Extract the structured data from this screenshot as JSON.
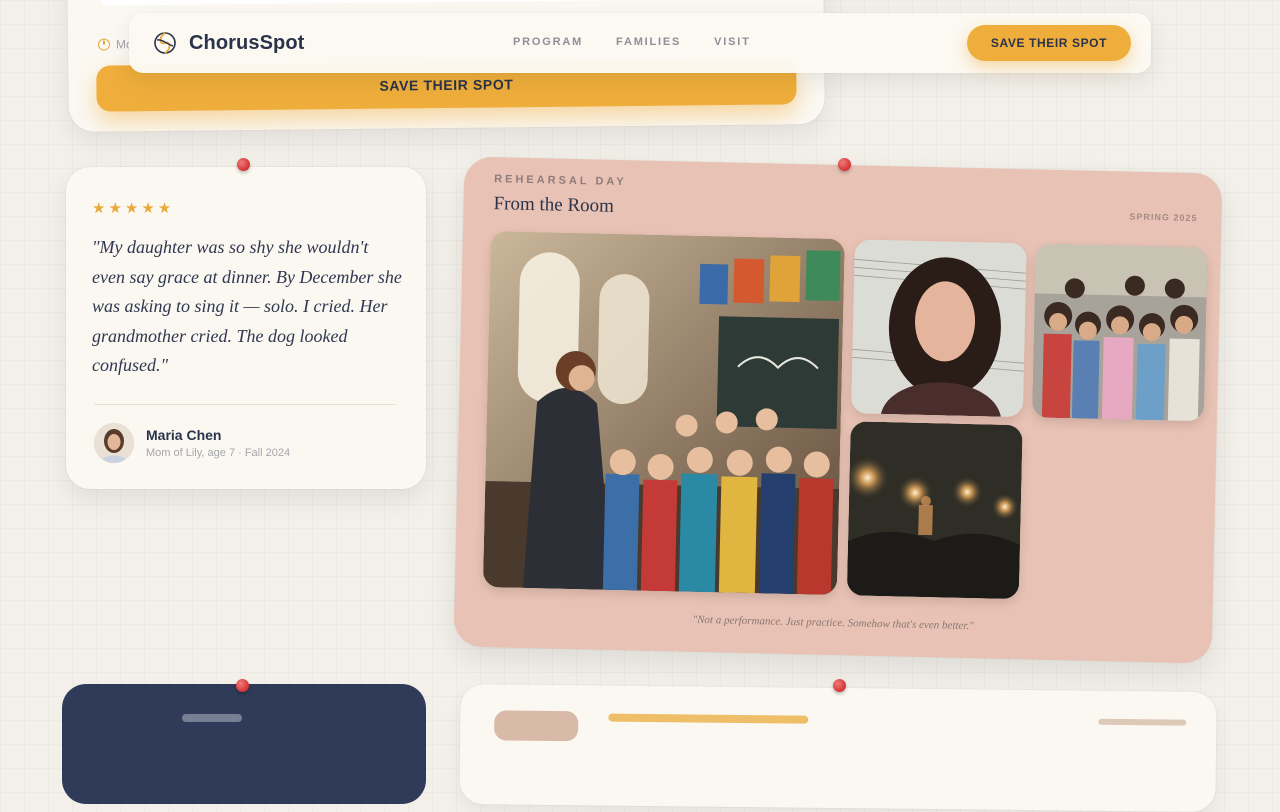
{
  "header": {
    "brand": "ChorusSpot",
    "logo_icon": "swirl-logo-icon",
    "nav": [
      "PROGRAM",
      "FAMILIES",
      "VISIT"
    ],
    "cta": "SAVE THEIR SPOT"
  },
  "top_card": {
    "meta_text": "Mo",
    "cta": "SAVE THEIR SPOT"
  },
  "testimonial": {
    "stars": "★★★★★",
    "rating": 5,
    "quote": "\"My daughter was so shy she wouldn't even say grace at dinner. By December she was asking to sing it — solo. I cried. Her grandmother cried. The dog looked confused.\"",
    "author": "Maria Chen",
    "author_sub": "Mom of Lily, age 7 · Fall 2024"
  },
  "gallery": {
    "eyebrow": "REHEARSAL DAY",
    "title": "From the Room",
    "season": "SPRING 2025",
    "caption": "\"Not a performance. Just practice. Somehow that's even better.\"",
    "photos": [
      "choir-rehearsal-photo",
      "singer-portrait-photo",
      "children-group-photo",
      "concert-stage-photo"
    ]
  },
  "colors": {
    "accent": "#efae3b",
    "navy": "#2f3b59",
    "gallery_bg": "#e8c2b4",
    "pin": "#d83c3c"
  }
}
